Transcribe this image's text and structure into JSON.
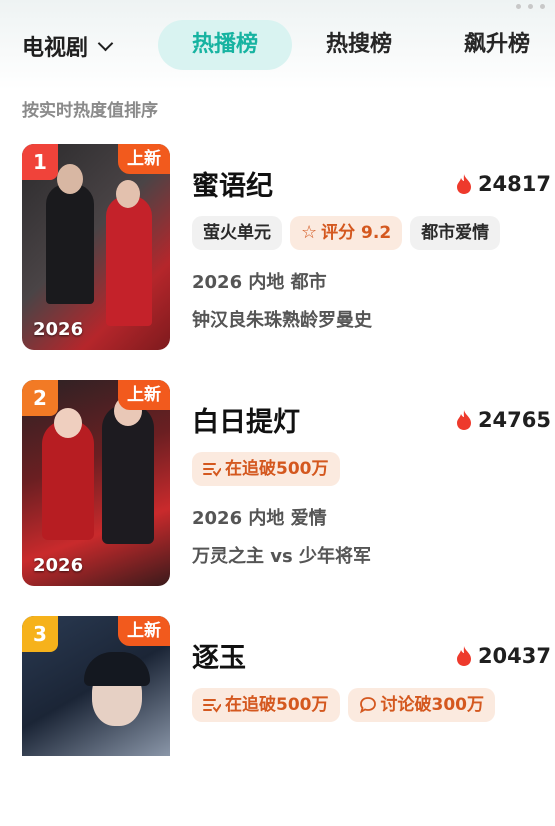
{
  "header": {
    "category": "电视剧",
    "tabs": [
      {
        "label": "热播榜",
        "active": true
      },
      {
        "label": "热搜榜",
        "active": false
      },
      {
        "label": "飙升榜",
        "active": false
      }
    ]
  },
  "subtitle": "按实时热度值排序",
  "items": [
    {
      "rank": "1",
      "new_label": "上新",
      "year": "2026",
      "title": "蜜语纪",
      "heat": "24817",
      "tag1": "萤火单元",
      "tag2": "评分 9.2",
      "tag3": "都市爱情",
      "meta": "2026 内地 都市",
      "tagline": "钟汉良朱珠熟龄罗曼史",
      "rank_color": "#f0433a"
    },
    {
      "rank": "2",
      "new_label": "上新",
      "year": "2026",
      "title": "白日提灯",
      "heat": "24765",
      "tag1": "在追破500万",
      "meta": "2026 内地 爱情",
      "tagline": "万灵之主 vs 少年将军",
      "rank_color": "#f27a25"
    },
    {
      "rank": "3",
      "new_label": "上新",
      "title": "逐玉",
      "heat": "20437",
      "tag1": "在追破500万",
      "tag2": "讨论破300万",
      "rank_color": "#f6b21b"
    }
  ],
  "colors": {
    "accent": "#17b3a1",
    "fire": "#ee3a2c",
    "tag_warm": "#d4581f"
  }
}
